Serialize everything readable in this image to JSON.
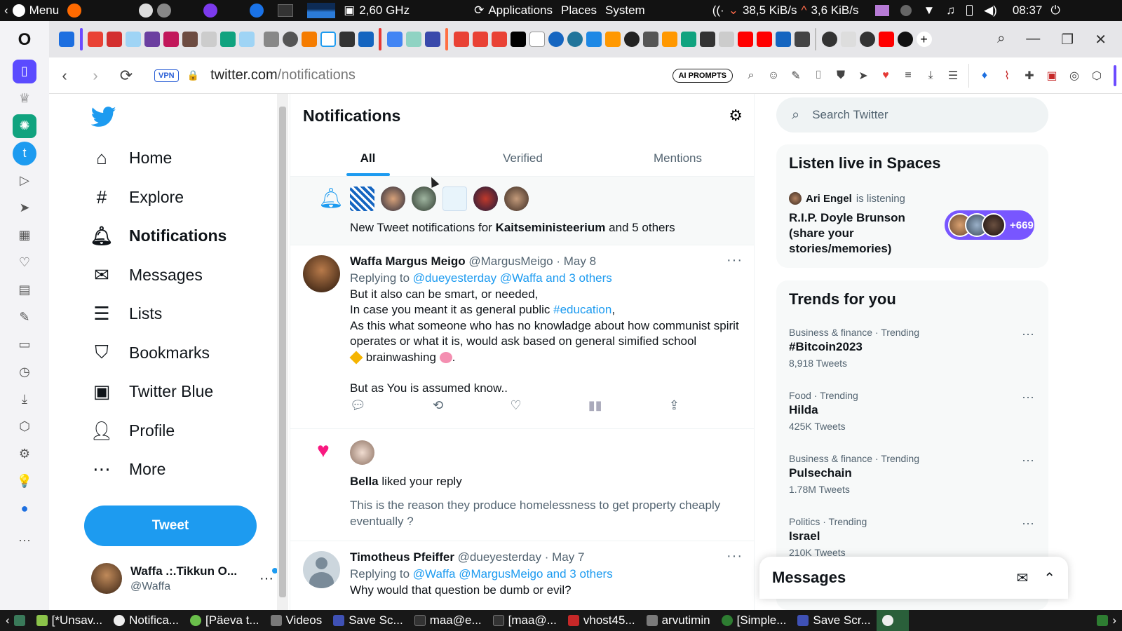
{
  "system_bar": {
    "menu_label": "Menu",
    "cpu_freq": "2,60 GHz",
    "applications": "Applications",
    "places": "Places",
    "system": "System",
    "net_down": "38,5 KiB/s",
    "net_up": "3,6 KiB/s",
    "clock": "08:37"
  },
  "browser": {
    "vpn_label": "VPN",
    "url_host": "twitter.com",
    "url_path": "/notifications",
    "ai_prompts_label": "AI PROMPTS"
  },
  "sidebar": {
    "items": [
      {
        "label": "Home",
        "icon": "home-icon"
      },
      {
        "label": "Explore",
        "icon": "hashtag-icon"
      },
      {
        "label": "Notifications",
        "icon": "bell-icon"
      },
      {
        "label": "Messages",
        "icon": "envelope-icon"
      },
      {
        "label": "Lists",
        "icon": "list-icon"
      },
      {
        "label": "Bookmarks",
        "icon": "bookmark-icon"
      },
      {
        "label": "Twitter Blue",
        "icon": "twitter-blue-icon"
      },
      {
        "label": "Profile",
        "icon": "person-icon"
      },
      {
        "label": "More",
        "icon": "more-circle-icon"
      }
    ],
    "tweet_button": "Tweet",
    "me_name": "Waffa .:.Tikkun O...",
    "me_handle": "@Waffa"
  },
  "notifications": {
    "title": "Notifications",
    "tabs": [
      "All",
      "Verified",
      "Mentions"
    ],
    "new_tweet_prefix": "New Tweet notifications for ",
    "new_tweet_bold": "Kaitseministeerium",
    "new_tweet_suffix": " and 5 others",
    "tweet1": {
      "name": "Waffa Margus Meigo",
      "handle": "@MargusMeigo",
      "date": "May 8",
      "replying_prefix": "Replying to ",
      "replying_links": "@dueyesterday @Waffa and 3 others",
      "line1": "But it also can be smart, or needed,",
      "line2_pre": "In case you meant it as general public ",
      "line2_tag": "#education",
      "line2_post": ",",
      "line3": "As this what someone who has no knowladge about how communist spirit operates or what it is, would ask based on general simified school",
      "line4": "brainwashing",
      "line5": "But as You is assumed know.."
    },
    "like1": {
      "name": "Bella",
      "action": " liked your reply",
      "quote": "This is the reason they produce homelessness to get property cheaply eventually ?"
    },
    "tweet2": {
      "name": "Timotheus Pfeiffer",
      "handle": "@dueyesterday",
      "date": "May 7",
      "replying_prefix": "Replying to ",
      "replying_links": "@Waffa @MargusMeigo and 3 others",
      "line1": "Why would that question be dumb or evil?"
    }
  },
  "right": {
    "search_placeholder": "Search Twitter",
    "spaces_title": "Listen live in Spaces",
    "spaces_host": "Ari Engel",
    "spaces_status": "is listening",
    "spaces_topic": "R.I.P. Doyle Brunson (share your stories/memories)",
    "spaces_count": "+669",
    "trends_title": "Trends for you",
    "trends": [
      {
        "category": "Business & finance · Trending",
        "name": "#Bitcoin2023",
        "count": "8,918 Tweets"
      },
      {
        "category": "Food · Trending",
        "name": "Hilda",
        "count": "425K Tweets"
      },
      {
        "category": "Business & finance · Trending",
        "name": "Pulsechain",
        "count": "1.78M Tweets"
      },
      {
        "category": "Politics · Trending",
        "name": "Israel",
        "count": "210K Tweets"
      }
    ],
    "messages_title": "Messages"
  },
  "taskbar": {
    "items": [
      "[*Unsav...",
      "Notifica...",
      "[Päeva t...",
      "Videos",
      "Save Sc...",
      "maa@e...",
      "[maa@...",
      "vhost45...",
      "arvutimin",
      "[Simple...",
      "Save Scr..."
    ]
  }
}
